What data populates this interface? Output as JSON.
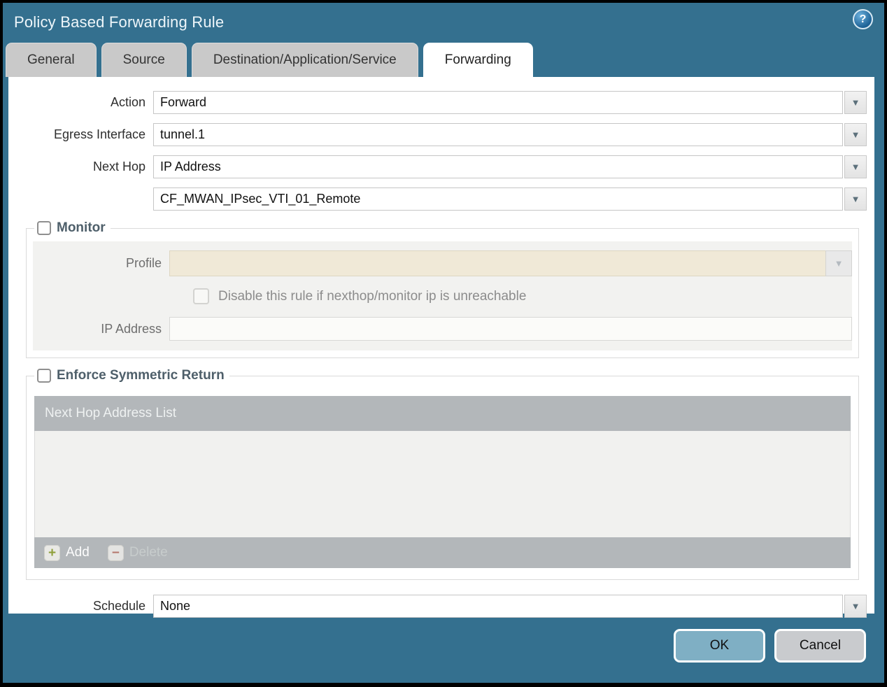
{
  "dialog": {
    "title": "Policy Based Forwarding Rule"
  },
  "tabs": [
    {
      "label": "General",
      "active": false
    },
    {
      "label": "Source",
      "active": false
    },
    {
      "label": "Destination/Application/Service",
      "active": false
    },
    {
      "label": "Forwarding",
      "active": true
    }
  ],
  "form": {
    "action": {
      "label": "Action",
      "value": "Forward"
    },
    "egress_interface": {
      "label": "Egress Interface",
      "value": "tunnel.1"
    },
    "next_hop": {
      "label": "Next Hop",
      "type_value": "IP Address",
      "address_value": "CF_MWAN_IPsec_VTI_01_Remote"
    },
    "schedule": {
      "label": "Schedule",
      "value": "None"
    }
  },
  "monitor": {
    "legend": "Monitor",
    "checked": false,
    "profile_label": "Profile",
    "profile_value": "",
    "disable_checkbox_label": "Disable this rule if nexthop/monitor ip is unreachable",
    "disable_checked": false,
    "ip_address_label": "IP Address",
    "ip_address_value": ""
  },
  "symmetric_return": {
    "legend": "Enforce Symmetric Return",
    "checked": false,
    "table_header": "Next Hop Address List",
    "rows": [],
    "add_label": "Add",
    "delete_label": "Delete"
  },
  "footer": {
    "ok_label": "OK",
    "cancel_label": "Cancel"
  },
  "icons": {
    "help": "?",
    "dropdown": "▼",
    "add": "+",
    "delete": "−"
  },
  "colors": {
    "titlebar_teal": "#34708F",
    "active_tab": "#FFFFFF",
    "inactive_tab": "#C9C9C9",
    "table_header_gray": "#B3B7BA",
    "profile_field_beige": "#F0E9D7",
    "ok_button_blue": "#7FAFC4",
    "cancel_button_gray": "#C9CBCE",
    "add_icon_green": "#8FA03A",
    "delete_icon_red": "#B5786E"
  }
}
